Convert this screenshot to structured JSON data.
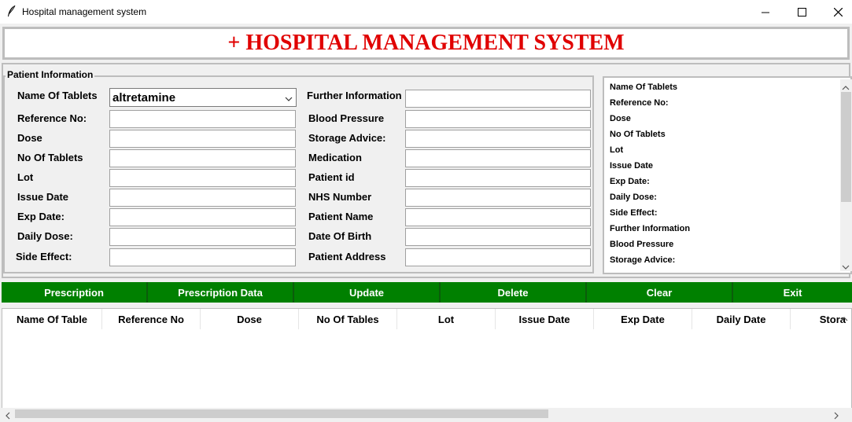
{
  "window": {
    "title": "Hospital management system",
    "icon": "feather-icon"
  },
  "header": {
    "title": "+ HOSPITAL MANAGEMENT SYSTEM",
    "color": "#e00000"
  },
  "form": {
    "group_label": "Patient Information",
    "left": [
      {
        "label": "Name Of Tablets",
        "value": "altretamine",
        "type": "combo"
      },
      {
        "label": "Reference No:",
        "value": ""
      },
      {
        "label": "Dose",
        "value": ""
      },
      {
        "label": "No Of Tablets",
        "value": ""
      },
      {
        "label": "Lot",
        "value": ""
      },
      {
        "label": "Issue Date",
        "value": ""
      },
      {
        "label": "Exp Date:",
        "value": ""
      },
      {
        "label": "Daily Dose:",
        "value": ""
      },
      {
        "label": "Side Effect:",
        "value": ""
      }
    ],
    "right": [
      {
        "label": "Further Information",
        "value": ""
      },
      {
        "label": "Blood Pressure",
        "value": ""
      },
      {
        "label": "Storage Advice:",
        "value": ""
      },
      {
        "label": "Medication",
        "value": ""
      },
      {
        "label": "Patient id",
        "value": ""
      },
      {
        "label": "NHS Number",
        "value": ""
      },
      {
        "label": "Patient Name",
        "value": ""
      },
      {
        "label": "Date Of Birth",
        "value": ""
      },
      {
        "label": "Patient Address",
        "value": ""
      }
    ]
  },
  "receipt": {
    "lines": [
      "Name Of Tablets",
      "Reference No:",
      "Dose",
      "No Of Tablets",
      "Lot",
      "Issue Date",
      "Exp Date:",
      "Daily Dose:",
      "Side Effect:",
      "Further Information",
      "Blood Pressure",
      "Storage Advice:"
    ]
  },
  "buttons": {
    "color": "#008000",
    "items": [
      "Prescription",
      "Prescription Data",
      "Update",
      "Delete",
      "Clear",
      "Exit"
    ]
  },
  "table": {
    "columns": [
      "Name Of Table",
      "Reference No",
      "Dose",
      "No Of Tables",
      "Lot",
      "Issue Date",
      "Exp Date",
      "Daily Date",
      "Stora"
    ]
  }
}
